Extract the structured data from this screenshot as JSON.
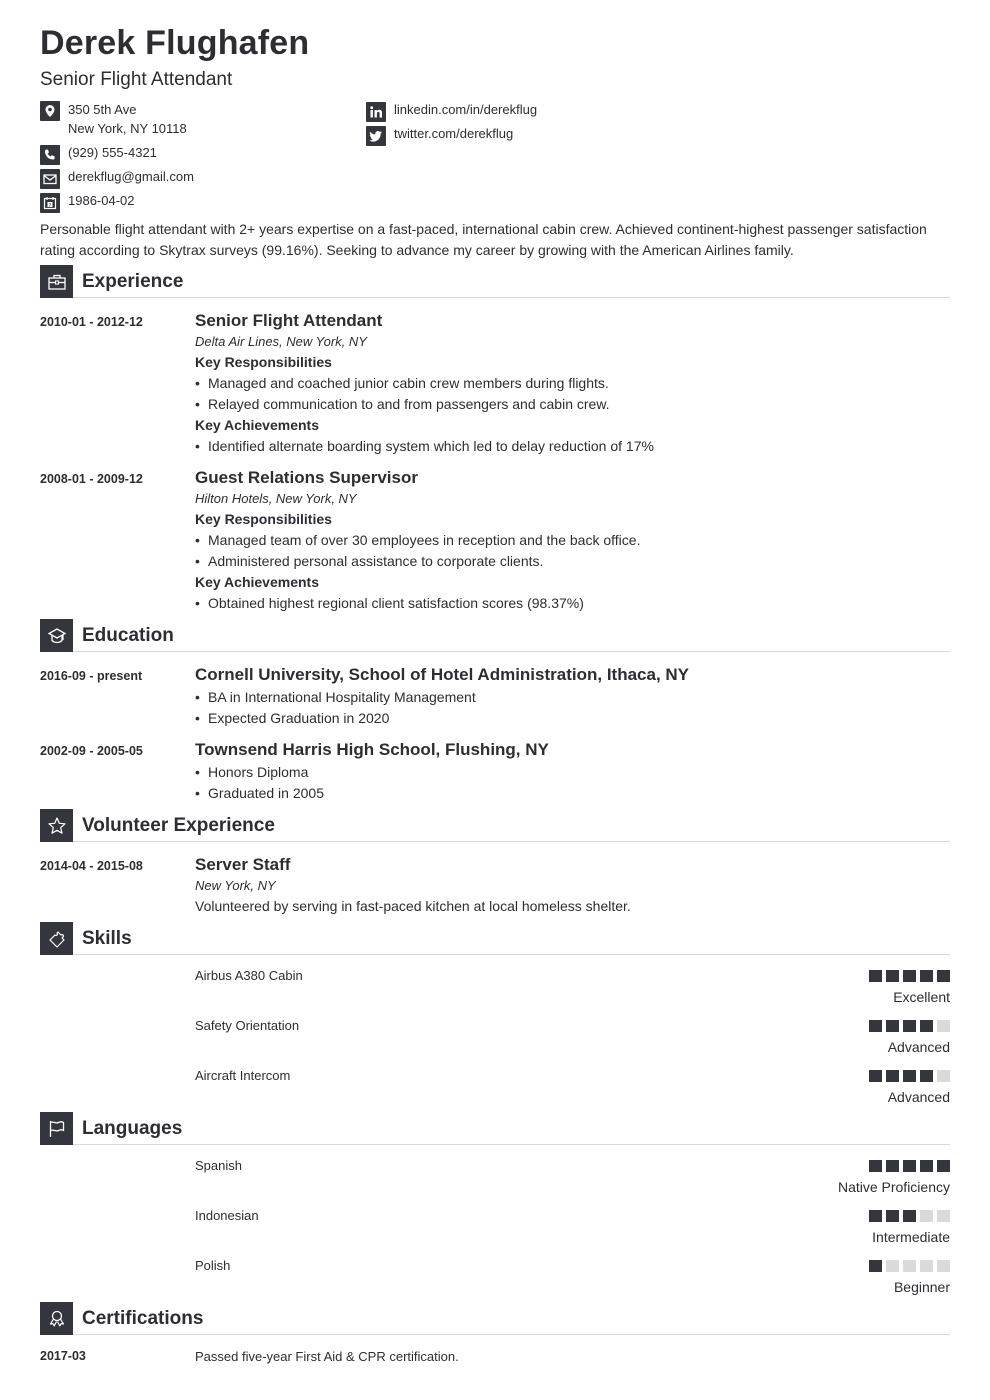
{
  "header": {
    "name": "Derek Flughafen",
    "title": "Senior Flight Attendant"
  },
  "contact": {
    "address_line1": "350 5th Ave",
    "address_line2": "New York, NY 10118",
    "phone": "(929) 555-4321",
    "email": "derekflug@gmail.com",
    "birthdate": "1986-04-02",
    "linkedin": "linkedin.com/in/derekflug",
    "twitter": "twitter.com/derekflug",
    "icons": [
      "map-pin-icon",
      "phone-icon",
      "envelope-icon",
      "calendar-icon",
      "linkedin-icon",
      "twitter-icon"
    ]
  },
  "summary": "Personable flight attendant with 2+ years expertise on a fast-paced, international cabin crew. Achieved continent-highest passenger satisfaction rating according to Skytrax surveys (99.16%). Seeking to advance my career by growing with the American Airlines family.",
  "sections": {
    "experience": "Experience",
    "education": "Education",
    "volunteer": "Volunteer Experience",
    "skills": "Skills",
    "languages": "Languages",
    "certifications": "Certifications"
  },
  "experience": [
    {
      "dates": "2010-01 - 2012-12",
      "title": "Senior Flight Attendant",
      "org": "Delta Air Lines, New York, NY",
      "resp_label": "Key Responsibilities",
      "responsibilities": [
        "Managed and coached junior cabin crew members during flights.",
        "Relayed communication to and from passengers and cabin crew."
      ],
      "ach_label": "Key Achievements",
      "achievements": [
        "Identified alternate boarding system which led to delay reduction of 17%"
      ]
    },
    {
      "dates": "2008-01 - 2009-12",
      "title": "Guest Relations Supervisor",
      "org": "Hilton Hotels, New York, NY",
      "resp_label": "Key Responsibilities",
      "responsibilities": [
        "Managed team of over 30 employees in reception and the back office.",
        "Administered personal assistance to corporate clients."
      ],
      "ach_label": "Key Achievements",
      "achievements": [
        "Obtained highest regional client satisfaction scores (98.37%)"
      ]
    }
  ],
  "education": [
    {
      "dates": "2016-09 - present",
      "title": "Cornell University, School of Hotel Administration, Ithaca, NY",
      "bullets": [
        "BA in International Hospitality Management",
        "Expected Graduation in 2020"
      ]
    },
    {
      "dates": "2002-09 - 2005-05",
      "title": "Townsend Harris High School, Flushing, NY",
      "bullets": [
        "Honors Diploma",
        "Graduated in 2005"
      ]
    }
  ],
  "volunteer": [
    {
      "dates": "2014-04 - 2015-08",
      "title": "Server Staff",
      "org": "New York, NY",
      "description": "Volunteered by serving in fast-paced kitchen at local homeless shelter."
    }
  ],
  "skills": [
    {
      "name": "Airbus A380 Cabin",
      "level": 5,
      "max": 5,
      "label": "Excellent"
    },
    {
      "name": "Safety Orientation",
      "level": 4,
      "max": 5,
      "label": "Advanced"
    },
    {
      "name": "Aircraft Intercom",
      "level": 4,
      "max": 5,
      "label": "Advanced"
    }
  ],
  "languages": [
    {
      "name": "Spanish",
      "level": 5,
      "max": 5,
      "label": "Native Proficiency"
    },
    {
      "name": "Indonesian",
      "level": 3,
      "max": 5,
      "label": "Intermediate"
    },
    {
      "name": "Polish",
      "level": 1,
      "max": 5,
      "label": "Beginner"
    }
  ],
  "certifications": [
    {
      "date": "2017-03",
      "text": "Passed five-year First Aid & CPR certification."
    }
  ],
  "colors": {
    "text": "#2c2e33",
    "icon_bg": "#33363c",
    "rating_on": "#33363c",
    "rating_off": "#dadada",
    "divider": "#d9d9d9"
  }
}
